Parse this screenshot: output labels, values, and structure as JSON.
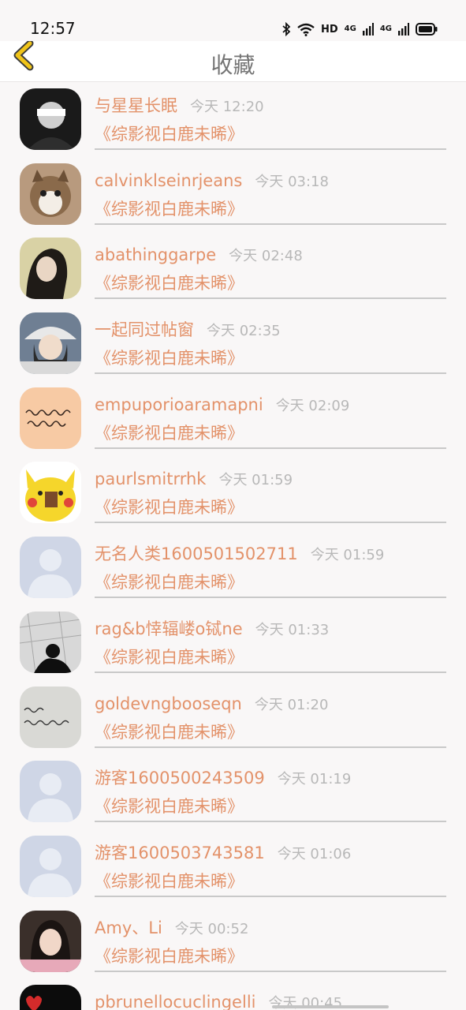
{
  "status_bar": {
    "time": "12:57",
    "network_label": "HD",
    "signal_1_label": "4G",
    "signal_2_label": "4G"
  },
  "header": {
    "title": "收藏",
    "back_icon": "chevron-left-icon",
    "back_color": "#f0c419"
  },
  "colors": {
    "accent": "#e3926a",
    "time": "#b8b8b8",
    "title": "#757575"
  },
  "items": [
    {
      "username": "与星星长眠",
      "time": "今天 12:20",
      "title": "《综影视白鹿未晞》",
      "avatar": "photo-dark-person"
    },
    {
      "username": "calvinklseinrjeans",
      "time": "今天 03:18",
      "title": "《综影视白鹿未晞》",
      "avatar": "photo-cat"
    },
    {
      "username": "abathinggarpe",
      "time": "今天 02:48",
      "title": "《综影视白鹿未晞》",
      "avatar": "photo-girl"
    },
    {
      "username": "一起同过帖窗",
      "time": "今天 02:35",
      "title": "《综影视白鹿未晞》",
      "avatar": "photo-girl-hat"
    },
    {
      "username": "empuporioaramapni",
      "time": "今天 02:09",
      "title": "《综影视白鹿未晞》",
      "avatar": "handwriting-peach"
    },
    {
      "username": "paurlsmitrrhk",
      "time": "今天 01:59",
      "title": "《综影视白鹿未晞》",
      "avatar": "pikachu"
    },
    {
      "username": "无名人类1600501502711",
      "time": "今天 01:59",
      "title": "《综影视白鹿未晞》",
      "avatar": "default-avatar"
    },
    {
      "username": "rag&b悻辐嵝o铽ne",
      "time": "今天 01:33",
      "title": "《综影视白鹿未晞》",
      "avatar": "photo-bw-person"
    },
    {
      "username": "goldevngbooseqn",
      "time": "今天 01:20",
      "title": "《综影视白鹿未晞》",
      "avatar": "handwriting-gray"
    },
    {
      "username": "游客1600500243509",
      "time": "今天 01:19",
      "title": "《综影视白鹿未晞》",
      "avatar": "default-avatar"
    },
    {
      "username": "游客1600503743581",
      "time": "今天 01:06",
      "title": "《综影视白鹿未晞》",
      "avatar": "default-avatar"
    },
    {
      "username": "Amy、Li",
      "time": "今天 00:52",
      "title": "《综影视白鹿未晞》",
      "avatar": "photo-pink-girl"
    },
    {
      "username": "pbrunellocuclingelli",
      "time": "今天 00:45",
      "title": "",
      "avatar": "heart-dark"
    }
  ]
}
